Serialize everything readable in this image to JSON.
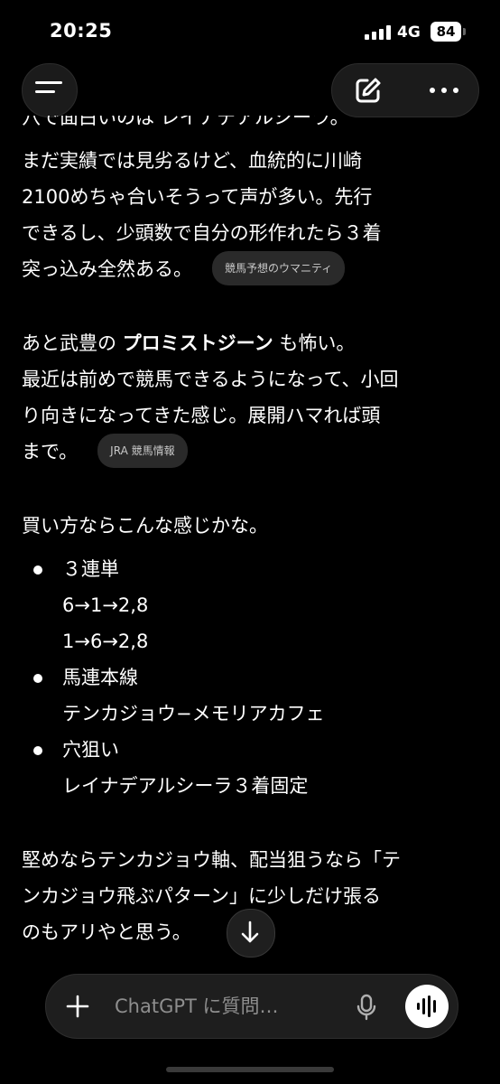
{
  "status": {
    "time": "20:25",
    "network": "4G",
    "battery": "84"
  },
  "message": {
    "top_partial": "穴で面白いのは レイナデアルシーラ。",
    "p1": [
      "まだ実績では見劣るけど、血統的に川崎",
      "2100めちゃ合いそうって声が多い。先行",
      "できるし、少頭数で自分の形作れたら３着",
      "突っ込み全然ある。"
    ],
    "source1": "競馬予想のウマニティ",
    "p2_prefix": "あと武豊の ",
    "p2_strong": "プロミストジーン",
    "p2_suffix": " も怖い。",
    "p2": [
      "最近は前めで競馬できるようになって、小回",
      "り向きになってきた感じ。展開ハマれば頭",
      "まで。"
    ],
    "source2": "JRA 競馬情報",
    "p3": "買い方ならこんな感じかな。",
    "bullets": [
      {
        "title": "３連単",
        "lines": [
          "6→1→2,8",
          "1→6→2,8"
        ]
      },
      {
        "title": "馬連本線",
        "lines": [
          "テンカジョウ−メモリアカフェ"
        ]
      },
      {
        "title": "穴狙い",
        "lines": [
          "レイナデアルシーラ３着固定"
        ]
      }
    ],
    "p4": [
      "堅めならテンカジョウ軸、配当狙うなら「テ",
      "ンカジョウ飛ぶパターン」に少しだけ張る",
      "のもアリやと思う。"
    ]
  },
  "composer": {
    "placeholder": "ChatGPT に質問…"
  },
  "icons": {
    "menu": "menu-icon",
    "edit": "edit-icon",
    "more": "more-icon",
    "scroll_down": "arrow-down-icon",
    "plus": "plus-icon",
    "mic": "mic-icon",
    "voice": "voice-waveform-icon"
  }
}
